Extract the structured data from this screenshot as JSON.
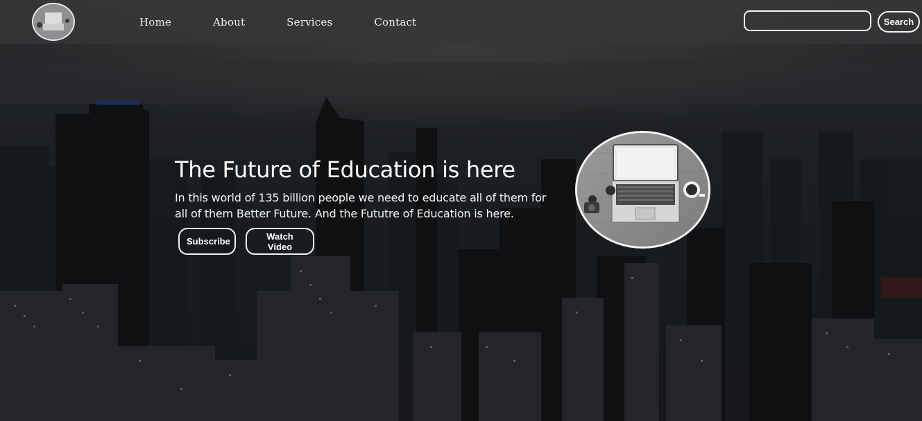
{
  "nav": {
    "logo_icon": "laptop-desk-photo",
    "links": [
      {
        "label": "Home"
      },
      {
        "label": "About"
      },
      {
        "label": "Services"
      },
      {
        "label": "Contact"
      }
    ],
    "search": {
      "placeholder": "",
      "value": "",
      "button_label": "Search"
    }
  },
  "hero": {
    "title": "The Future of Education is here",
    "description": "In this world of 135 billion people we need to educate all of them for all of them Better Future. And the Fututre of Education is here.",
    "buttons": {
      "subscribe": "Subscribe",
      "watch_video": "Watch Video"
    },
    "image_icon": "laptop-desk-photo"
  },
  "background_icon": "night-city-skyline-photo",
  "colors": {
    "navbar": "#373738",
    "text": "#ffffff",
    "outline": "#f2f2f2"
  }
}
